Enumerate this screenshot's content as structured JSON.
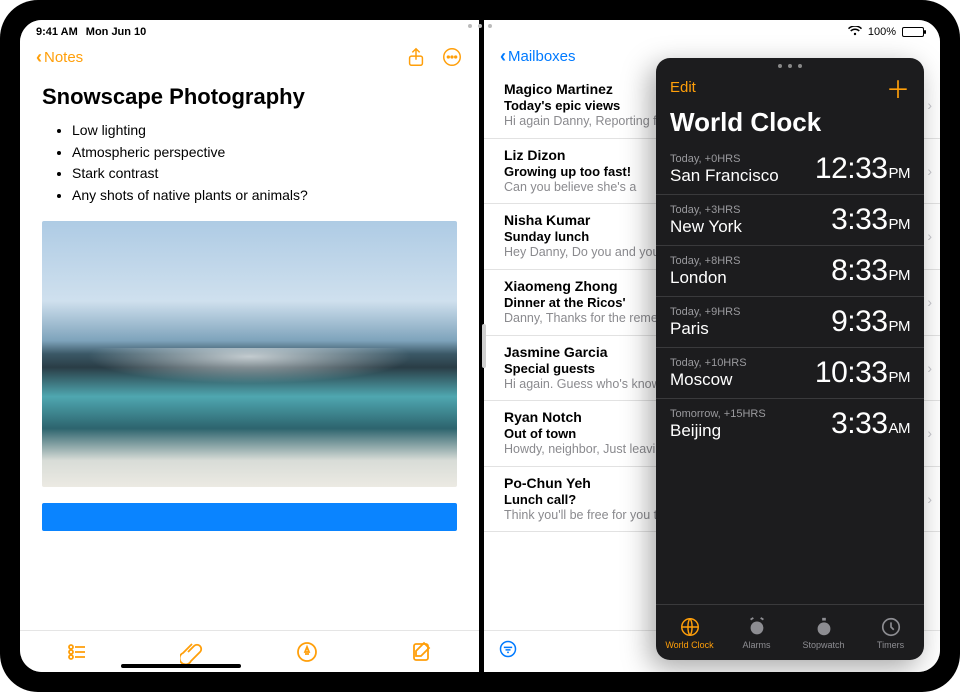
{
  "status": {
    "time": "9:41 AM",
    "date": "Mon Jun 10",
    "battery": "100%"
  },
  "notes": {
    "back_label": "Notes",
    "title": "Snowscape Photography",
    "bullets": [
      "Low lighting",
      "Atmospheric perspective",
      "Stark contrast",
      "Any shots of native plants or animals?"
    ]
  },
  "mail": {
    "back_label": "Mailboxes",
    "items": [
      {
        "sender": "Magico Martinez",
        "subject": "Today's epic views",
        "preview": "Hi again Danny, Reporting from the field. Wide open skies, a ger"
      },
      {
        "sender": "Liz Dizon",
        "subject": "Growing up too fast!",
        "preview": "Can you believe she's a"
      },
      {
        "sender": "Nisha Kumar",
        "subject": "Sunday lunch",
        "preview": "Hey Danny, Do you and your dad? If you two join, th"
      },
      {
        "sender": "Xiaomeng Zhong",
        "subject": "Dinner at the Ricos'",
        "preview": "Danny, Thanks for the remembered to take or"
      },
      {
        "sender": "Jasmine Garcia",
        "subject": "Special guests",
        "preview": "Hi again. Guess who's know how to make me"
      },
      {
        "sender": "Ryan Notch",
        "subject": "Out of town",
        "preview": "Howdy, neighbor, Just leaving Tuesday and w"
      },
      {
        "sender": "Po-Chun Yeh",
        "subject": "Lunch call?",
        "preview": "Think you'll be free for you think might work a"
      }
    ]
  },
  "clock": {
    "edit_label": "Edit",
    "title": "World Clock",
    "cities": [
      {
        "offset": "Today, +0HRS",
        "name": "San Francisco",
        "time": "12:33",
        "ampm": "PM"
      },
      {
        "offset": "Today, +3HRS",
        "name": "New York",
        "time": "3:33",
        "ampm": "PM"
      },
      {
        "offset": "Today, +8HRS",
        "name": "London",
        "time": "8:33",
        "ampm": "PM"
      },
      {
        "offset": "Today, +9HRS",
        "name": "Paris",
        "time": "9:33",
        "ampm": "PM"
      },
      {
        "offset": "Today, +10HRS",
        "name": "Moscow",
        "time": "10:33",
        "ampm": "PM"
      },
      {
        "offset": "Tomorrow, +15HRS",
        "name": "Beijing",
        "time": "3:33",
        "ampm": "AM"
      }
    ],
    "tabs": [
      {
        "label": "World Clock"
      },
      {
        "label": "Alarms"
      },
      {
        "label": "Stopwatch"
      },
      {
        "label": "Timers"
      }
    ]
  }
}
